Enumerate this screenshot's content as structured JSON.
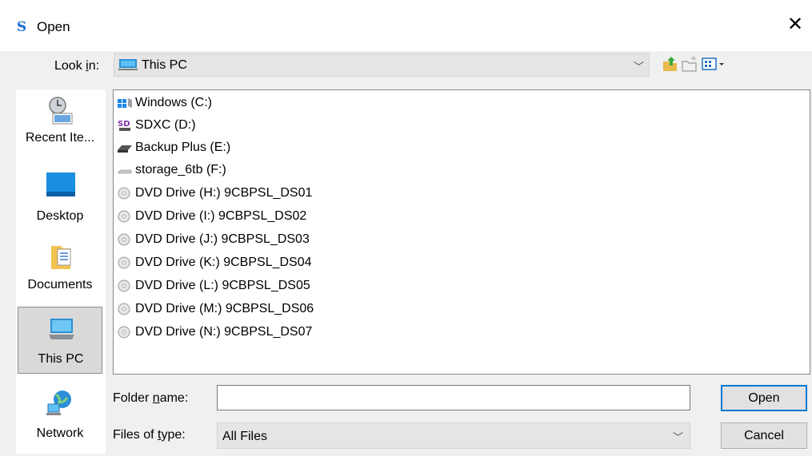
{
  "window": {
    "title": "Open",
    "app_icon_glyph": "S",
    "close_glyph": "✕"
  },
  "lookin": {
    "label_pre": "Look ",
    "label_accel": "i",
    "label_post": "n:",
    "value": "This PC",
    "value_icon": "computer-icon"
  },
  "toolbar": {
    "up_icon": "up-folder-icon",
    "newfolder_icon": "new-folder-icon",
    "view_icon": "view-menu-icon"
  },
  "places": [
    {
      "label": "Recent Ite...",
      "icon": "recent-items-icon"
    },
    {
      "label": "Desktop",
      "icon": "desktop-icon"
    },
    {
      "label": "Documents",
      "icon": "documents-icon"
    },
    {
      "label": "This PC",
      "icon": "computer-icon",
      "selected": true
    },
    {
      "label": "Network",
      "icon": "network-icon"
    }
  ],
  "files": [
    {
      "label": "Windows (C:)",
      "icon": "windows-drive-icon"
    },
    {
      "label": "SDXC (D:)",
      "icon": "sd-card-icon"
    },
    {
      "label": "Backup Plus (E:)",
      "icon": "hard-drive-icon"
    },
    {
      "label": "storage_6tb (F:)",
      "icon": "removable-drive-icon"
    },
    {
      "label": "DVD Drive (H:) 9CBPSL_DS01",
      "icon": "dvd-drive-icon"
    },
    {
      "label": "DVD Drive (I:) 9CBPSL_DS02",
      "icon": "dvd-drive-icon"
    },
    {
      "label": "DVD Drive (J:) 9CBPSL_DS03",
      "icon": "dvd-drive-icon"
    },
    {
      "label": "DVD Drive (K:) 9CBPSL_DS04",
      "icon": "dvd-drive-icon"
    },
    {
      "label": "DVD Drive (L:) 9CBPSL_DS05",
      "icon": "dvd-drive-icon"
    },
    {
      "label": "DVD Drive (M:) 9CBPSL_DS06",
      "icon": "dvd-drive-icon"
    },
    {
      "label": "DVD Drive (N:) 9CBPSL_DS07",
      "icon": "dvd-drive-icon"
    }
  ],
  "folder_name": {
    "label_pre": "Folder ",
    "label_accel": "n",
    "label_post": "ame:",
    "value": ""
  },
  "files_of_type": {
    "label_pre": "Files of ",
    "label_accel": "t",
    "label_post": "ype:",
    "value": "All Files"
  },
  "buttons": {
    "open": "Open",
    "cancel": "Cancel"
  },
  "colors": {
    "accent": "#0078d7",
    "dialog_bg": "#f0f0f0"
  }
}
